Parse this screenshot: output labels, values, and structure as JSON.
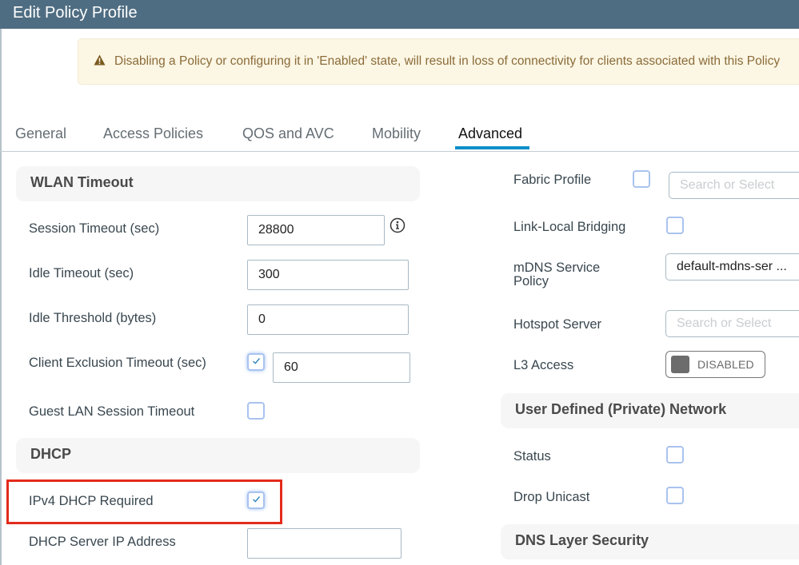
{
  "window": {
    "title": "Edit Policy Profile"
  },
  "alert": {
    "icon": "warning-triangle-icon",
    "message": "Disabling a Policy or configuring it in 'Enabled' state, will result in loss of connectivity for clients associated with this Policy"
  },
  "tabs": [
    {
      "label": "General",
      "active": false
    },
    {
      "label": "Access Policies",
      "active": false
    },
    {
      "label": "QOS and AVC",
      "active": false
    },
    {
      "label": "Mobility",
      "active": false
    },
    {
      "label": "Advanced",
      "active": true
    }
  ],
  "left": {
    "wlan_timeout": {
      "title": "WLAN Timeout",
      "session_timeout": {
        "label": "Session Timeout (sec)",
        "value": "28800",
        "info_icon": "info-icon"
      },
      "idle_timeout": {
        "label": "Idle Timeout (sec)",
        "value": "300"
      },
      "idle_threshold": {
        "label": "Idle Threshold (bytes)",
        "value": "0"
      },
      "client_exclusion": {
        "label": "Client Exclusion Timeout (sec)",
        "checked": true,
        "value": "60"
      },
      "guest_lan": {
        "label": "Guest LAN Session Timeout",
        "checked": false
      }
    },
    "dhcp": {
      "title": "DHCP",
      "ipv4_required": {
        "label": "IPv4 DHCP Required",
        "checked": true,
        "highlighted": true
      },
      "server_ip": {
        "label": "DHCP Server IP Address",
        "value": ""
      }
    }
  },
  "right": {
    "fabric_profile": {
      "label": "Fabric Profile",
      "checked": false,
      "placeholder": "Search or Select"
    },
    "link_local_bridging": {
      "label": "Link-Local Bridging",
      "checked": false
    },
    "mdns_policy": {
      "label_line1": "mDNS Service",
      "label_line2": "Policy",
      "value": "default-mdns-ser ..."
    },
    "hotspot_server": {
      "label": "Hotspot Server",
      "placeholder": "Search or Select"
    },
    "l3_access": {
      "label": "L3 Access",
      "state": "DISABLED"
    },
    "udn": {
      "title": "User Defined (Private) Network",
      "status": {
        "label": "Status",
        "checked": false
      },
      "drop_unicast": {
        "label": "Drop Unicast",
        "checked": false
      }
    },
    "dns_layer_security": {
      "title": "DNS Layer Security"
    }
  },
  "colors": {
    "titlebar": "#4f6d82",
    "tab_active_ink": "#0d8fca",
    "alert_bg": "#fcf6e4",
    "alert_text": "#8a6c3a",
    "highlight_box": "#e32b1c"
  }
}
